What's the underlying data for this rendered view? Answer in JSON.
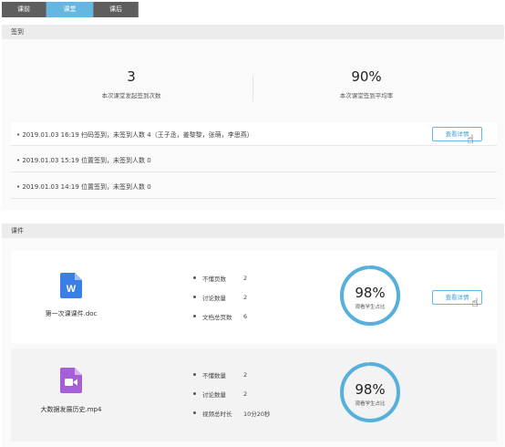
{
  "tabs": [
    {
      "label": "课前"
    },
    {
      "label": "课堂"
    },
    {
      "label": "课后"
    }
  ],
  "checkin": {
    "header": "签到",
    "stats": [
      {
        "value": "3",
        "label": "本次课堂发起签到次数"
      },
      {
        "value": "90%",
        "label": "本次课堂签到平均率"
      }
    ],
    "records": [
      {
        "text": "• 2019.01.03 16:19 扫码签到，未签到人数 4（王子丞，姜黎黎，张萌，李思燕）"
      },
      {
        "text": "• 2019.01.03 15:19 位置签到，未签到人数 0"
      },
      {
        "text": "• 2019.01.03 14:19 位置签到，未签到人数 0"
      }
    ],
    "detail_button": "查看详情"
  },
  "courseware": {
    "header": "课件",
    "detail_button": "查看详情",
    "items": [
      {
        "file_name": "第一次课课件.doc",
        "icon": "word-doc-icon",
        "icon_color": "#3a7fe8",
        "icon_letter": "W",
        "meta": [
          {
            "key": "不懂页数",
            "value": "2"
          },
          {
            "key": "讨论数量",
            "value": "2"
          },
          {
            "key": "文档总页数",
            "value": "6"
          }
        ],
        "percent": 0.98,
        "percent_text": "98%",
        "ring_label": "观看学生占比"
      },
      {
        "file_name": "大数据发展历史.mp4",
        "icon": "video-file-icon",
        "icon_color": "#a65fd6",
        "meta": [
          {
            "key": "不懂数量",
            "value": "2"
          },
          {
            "key": "讨论数量",
            "value": "2"
          },
          {
            "key": "视频总时长",
            "value": "10分20秒"
          }
        ],
        "percent": 0.98,
        "percent_text": "98%",
        "ring_label": "观看学生占比"
      }
    ]
  },
  "colors": {
    "accent": "#63b7e3",
    "ring_track": "#e4e4e4",
    "ring_fill": "#56b0dc"
  }
}
